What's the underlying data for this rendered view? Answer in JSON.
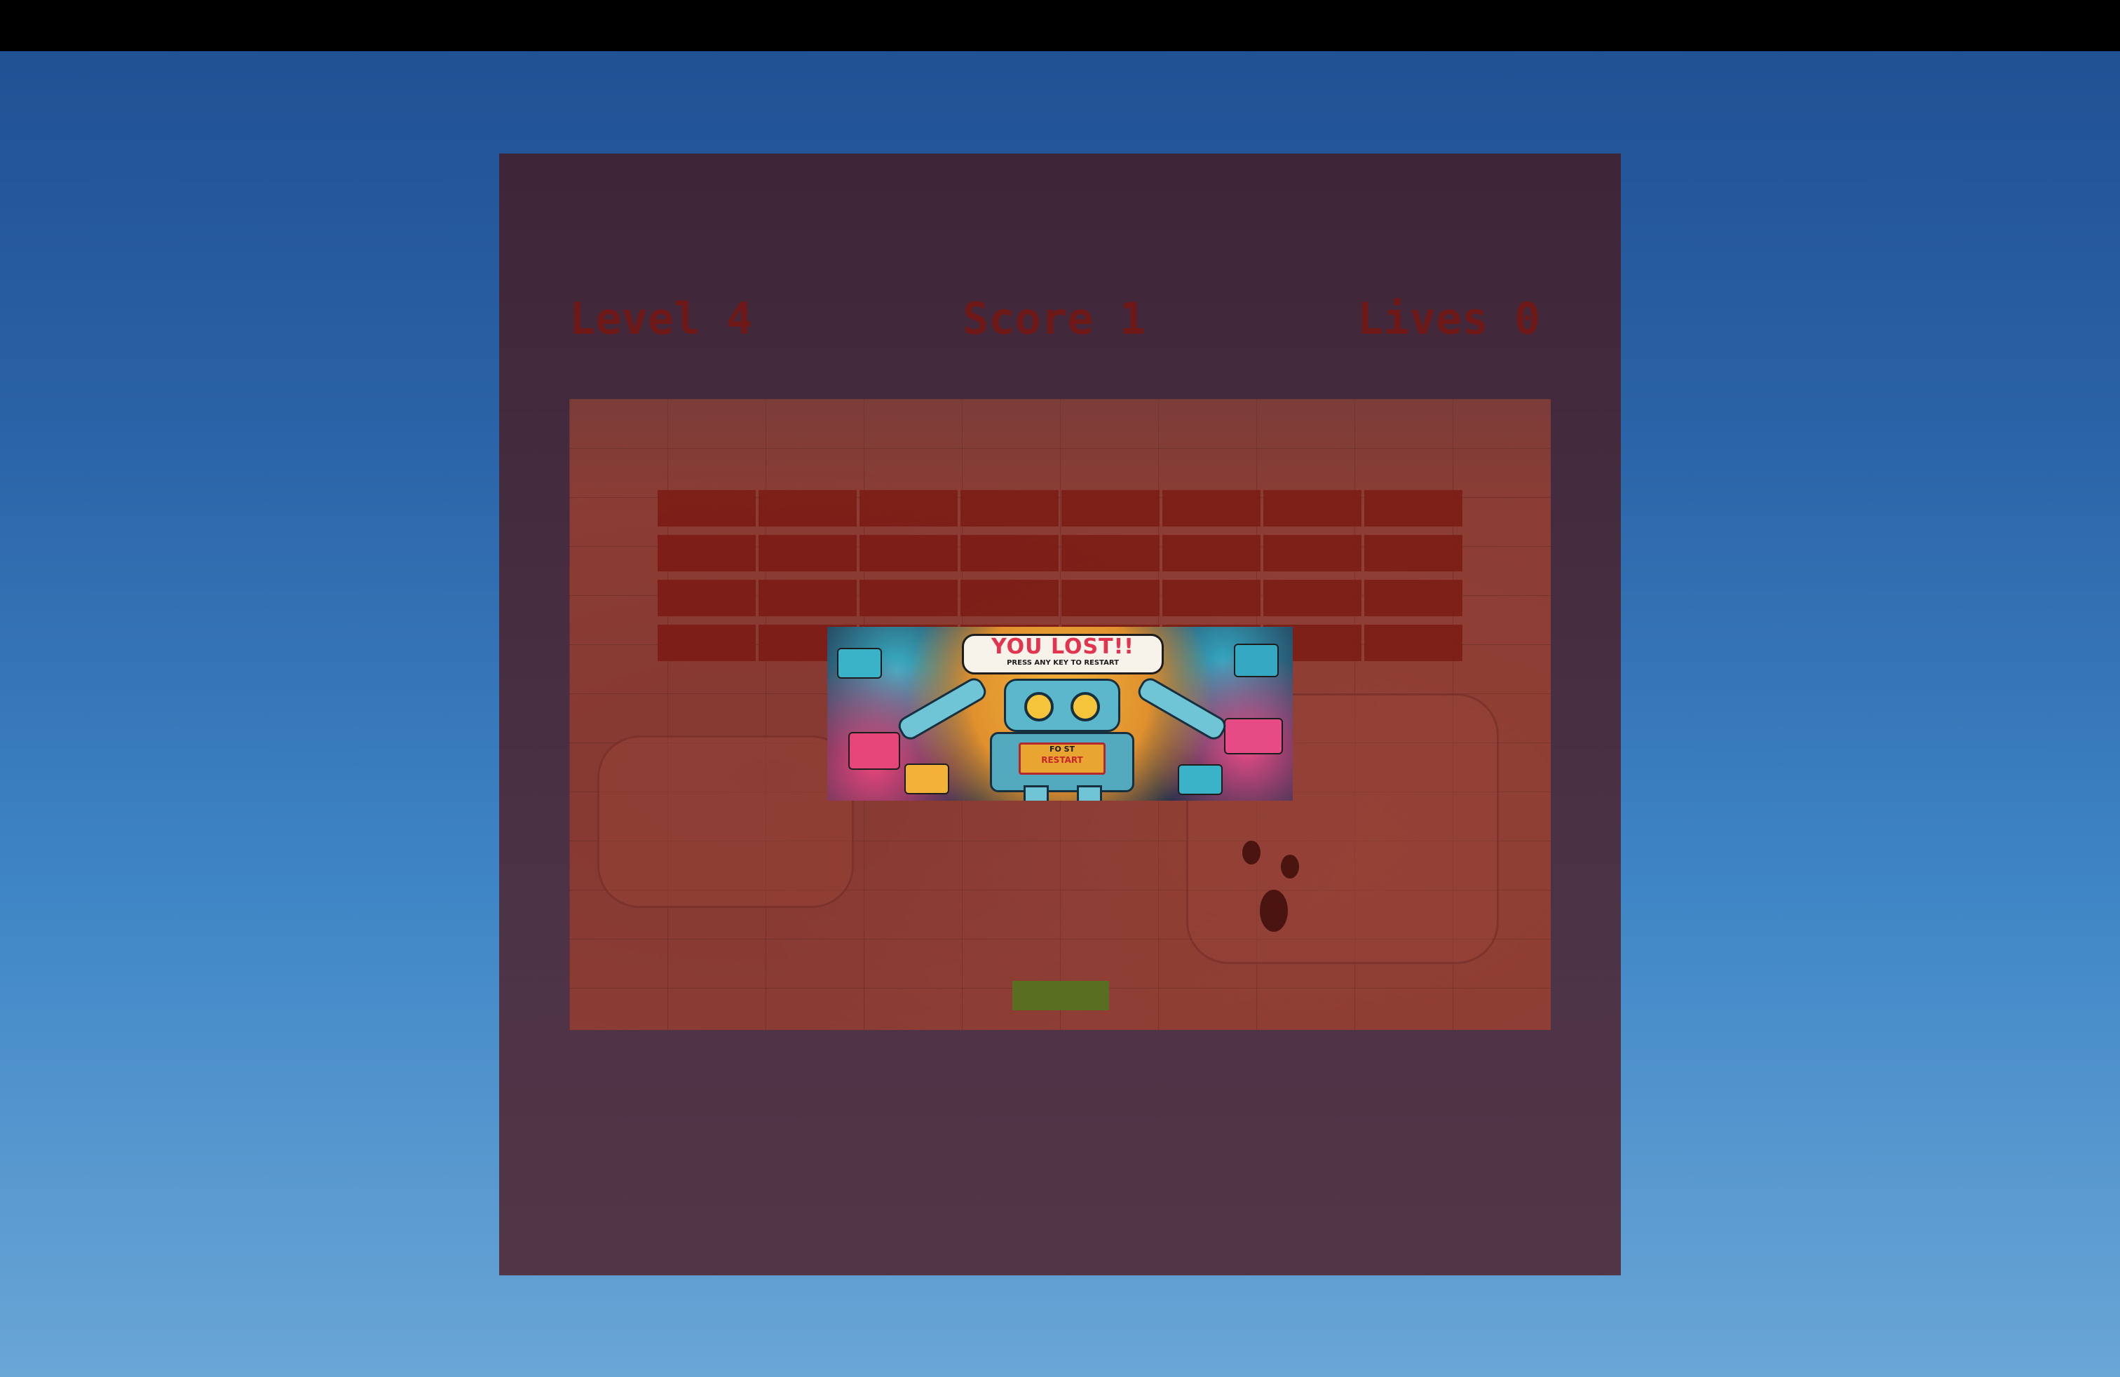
{
  "hud": {
    "level_label": "Level 4",
    "score_label": "Score 1",
    "lives_label": "Lives 0"
  },
  "game_over": {
    "title": "YOU LOST!!",
    "subtitle": "PRESS ANY KEY TO RESTART",
    "panel_line1": "FO ST",
    "panel_line2": "RESTART"
  },
  "bricks": {
    "rows": 4,
    "columns": 8,
    "color": "#7c1d16"
  },
  "colors": {
    "panel": "#3e2638",
    "hud_text": "#6e1818",
    "paddle": "#5a6e22",
    "bubble_title": "#e2344f"
  },
  "icons": {
    "robot": "robot-illustration"
  }
}
